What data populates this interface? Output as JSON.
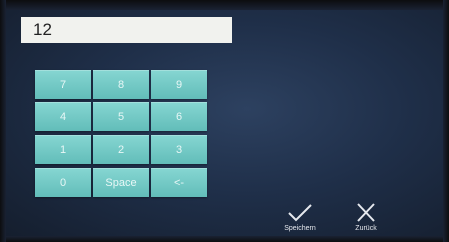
{
  "input": {
    "value": "12"
  },
  "keypad": {
    "keys": [
      "7",
      "8",
      "9",
      "4",
      "5",
      "6",
      "1",
      "2",
      "3",
      "0",
      "Space",
      "<-"
    ]
  },
  "actions": {
    "save_label": "Speichern",
    "back_label": "Zurück"
  },
  "colors": {
    "key_background": "#6fc8c4",
    "screen_background": "#233450",
    "display_background": "#f1f2ee"
  },
  "icons": {
    "save": "checkmark-icon",
    "back": "x-icon"
  }
}
